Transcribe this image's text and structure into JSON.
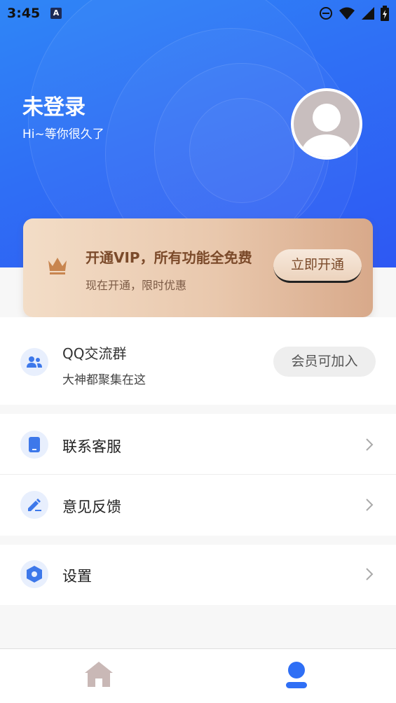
{
  "status_bar": {
    "time": "3:45",
    "notification_badge": "A",
    "icons": [
      "do-not-disturb-icon",
      "wifi-icon",
      "signal-icon",
      "battery-icon"
    ]
  },
  "profile": {
    "title": "未登录",
    "subtitle": "Hi~等你很久了"
  },
  "vip": {
    "title": "开通VIP，所有功能全免费",
    "subtitle": "现在开通，限时优惠",
    "button": "立即开通"
  },
  "qq_group": {
    "title": "QQ交流群",
    "subtitle": "大神都聚集在这",
    "button": "会员可加入"
  },
  "menu": [
    {
      "label": "联系客服",
      "icon": "phone-icon"
    },
    {
      "label": "意见反馈",
      "icon": "edit-icon"
    },
    {
      "label": "设置",
      "icon": "settings-icon"
    }
  ],
  "tabbar": {
    "tabs": [
      {
        "icon": "home-icon",
        "active": false
      },
      {
        "icon": "user-icon",
        "active": true
      }
    ]
  },
  "colors": {
    "primary": "#2f6ff5",
    "accent_icon": "#3d78ea",
    "vip_text": "#7b4a2a",
    "inactive_tab": "#c9b8b6"
  }
}
